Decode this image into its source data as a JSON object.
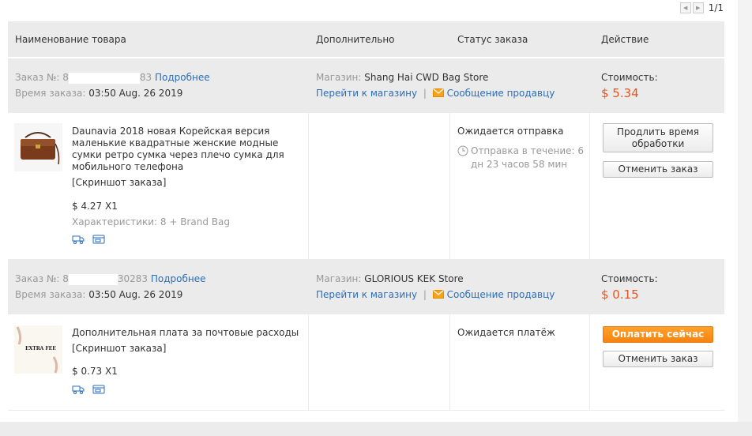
{
  "pagination": {
    "text": "1/1"
  },
  "table": {
    "headers": {
      "product": "Наименование товара",
      "extra": "Дополнительно",
      "status": "Статус заказа",
      "action": "Действие"
    }
  },
  "orders": [
    {
      "order_label": "Заказ №:",
      "order_no_start": "8",
      "order_no_end": "83",
      "details_link": "Подробнее",
      "time_label": "Время заказа:",
      "time_value": "03:50 Aug. 26 2019",
      "shop_label": "Магазин:",
      "shop_name": "Shang Hai CWD Bag Store",
      "go_to_shop": "Перейти к магазину",
      "separator": "|",
      "message_seller": "Сообщение продавцу",
      "cost_label": "Стоимость:",
      "cost_value": "$ 5.34",
      "item": {
        "title": "Daunavia 2018 новая Корейская версия маленькие квадратные женские модные сумки ретро сумка через плечо сумка для мобильного телефона",
        "snapshot": "[Скриншот заказа]",
        "price_qty": "$ 4.27 X1",
        "props": "Характеристики: 8 + Brand Bag"
      },
      "status": "Ожидается отправка",
      "status_detail": "Отправка в течение: 6 дн 23 часов 58 мин",
      "buttons": [
        "Продлить время обработки",
        "Отменить заказ"
      ]
    },
    {
      "order_label": "Заказ №:",
      "order_no_start": "8",
      "order_no_end": "30283",
      "details_link": "Подробнее",
      "time_label": "Время заказа:",
      "time_value": "03:50 Aug. 26 2019",
      "shop_label": "Магазин:",
      "shop_name": "GLORIOUS KEK Store",
      "go_to_shop": "Перейти к магазину",
      "separator": "|",
      "message_seller": "Сообщение продавцу",
      "cost_label": "Стоимость:",
      "cost_value": "$ 0.15",
      "item": {
        "title": "Дополнительная плата за почтовые расходы",
        "snapshot": "[Скриншот заказа]",
        "price_qty": "$ 0.73 X1",
        "image_text": "EXTRA FEE"
      },
      "status": "Ожидается платёж",
      "buttons": [
        "Оплатить сейчас",
        "Отменить заказ"
      ]
    }
  ],
  "icons": {
    "prev": "chevron-left-icon",
    "next": "chevron-right-icon",
    "mail": "mail-icon",
    "clock": "clock-icon",
    "truck": "truck-icon",
    "wallet": "wallet-icon"
  },
  "colors": {
    "link": "#2a6ebb",
    "price": "#e5541e",
    "pay_button": "#f7830f",
    "header_bg": "#ebebeb"
  }
}
